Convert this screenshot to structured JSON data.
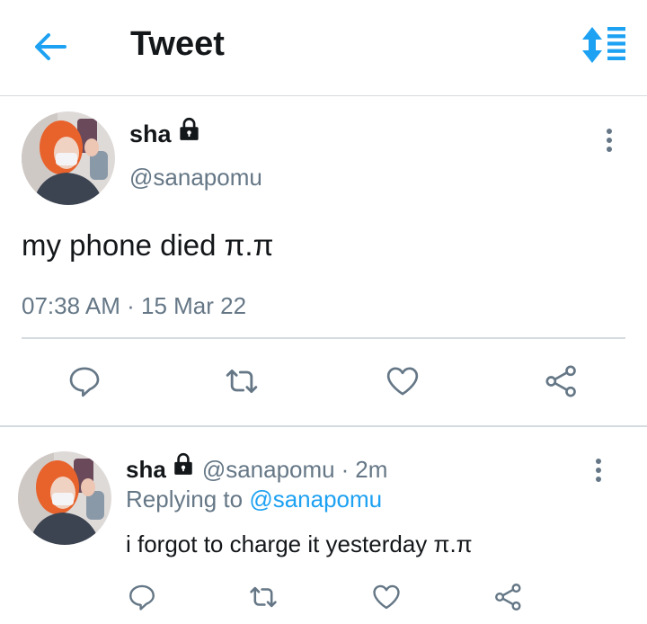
{
  "header": {
    "title": "Tweet",
    "icons": {
      "back": "back-arrow-icon",
      "sort": "sort-icon"
    },
    "accent": "#1da1f2"
  },
  "tweet": {
    "name": "sha",
    "handle": "@sanapomu",
    "text": "my phone died π.π",
    "time": "07:38 AM",
    "sep": "·",
    "date": "15 Mar 22",
    "actions": [
      "reply-icon",
      "retweet-icon",
      "like-icon",
      "share-icon"
    ]
  },
  "reply": {
    "name": "sha",
    "handle": "@sanapomu",
    "sep": "·",
    "time": "2m",
    "replying_prefix": "Replying to",
    "replying_handle": "@sanapomu",
    "text": "i forgot to charge it yesterday π.π",
    "actions": [
      "reply-icon",
      "retweet-icon",
      "like-icon",
      "share-icon"
    ]
  },
  "colors": {
    "text": "#14171a",
    "secondary": "#657786",
    "accent": "#1da1f2",
    "divider": "#d6dbdf"
  }
}
